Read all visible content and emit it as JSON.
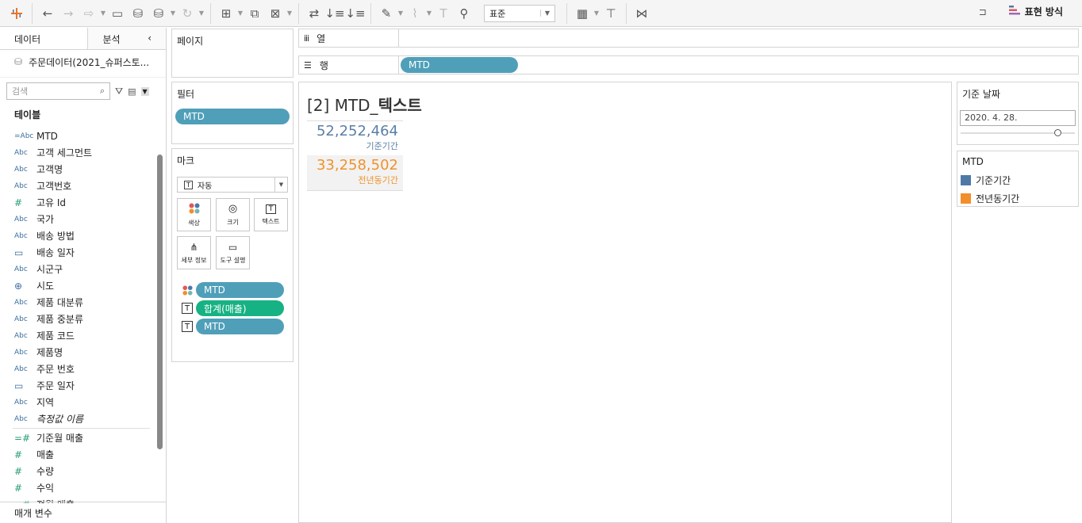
{
  "toolbar": {
    "fit_value": "표준",
    "show_me_label": "표현 방식"
  },
  "data_pane": {
    "tab_data": "데이터",
    "tab_analytics": "분석",
    "datasource_name": "주문데이터(2021_슈퍼스토...",
    "search_placeholder": "검색",
    "tables_title": "테이블",
    "fields": [
      {
        "icon": "=Abc",
        "name": "MTD"
      },
      {
        "icon": "Abc",
        "name": "고객 세그먼트"
      },
      {
        "icon": "Abc",
        "name": "고객명"
      },
      {
        "icon": "Abc",
        "name": "고객번호"
      },
      {
        "icon": "#",
        "name": "고유 Id"
      },
      {
        "icon": "Abc",
        "name": "국가"
      },
      {
        "icon": "Abc",
        "name": "배송 방법"
      },
      {
        "icon": "cal",
        "name": "배송 일자"
      },
      {
        "icon": "Abc",
        "name": "시군구"
      },
      {
        "icon": "globe",
        "name": "시도"
      },
      {
        "icon": "Abc",
        "name": "제품 대분류"
      },
      {
        "icon": "Abc",
        "name": "제품 중분류"
      },
      {
        "icon": "Abc",
        "name": "제품 코드"
      },
      {
        "icon": "Abc",
        "name": "제품명"
      },
      {
        "icon": "Abc",
        "name": "주문 번호"
      },
      {
        "icon": "cal",
        "name": "주문 일자"
      },
      {
        "icon": "Abc",
        "name": "지역"
      },
      {
        "icon": "Abc",
        "name": "측정값 이름"
      }
    ],
    "measures": [
      {
        "icon": "=#",
        "name": "기준월 매출"
      },
      {
        "icon": "#",
        "name": "매출"
      },
      {
        "icon": "#",
        "name": "수량"
      },
      {
        "icon": "#",
        "name": "수익"
      },
      {
        "icon": "=#",
        "name": "전월 매출"
      }
    ],
    "parameters_label": "매개 변수"
  },
  "pages_card": {
    "title": "페이지"
  },
  "filters_card": {
    "title": "필터",
    "pills": [
      "MTD"
    ]
  },
  "marks_card": {
    "title": "마크",
    "mark_type": "자동",
    "buttons": [
      "색상",
      "크기",
      "텍스트",
      "세부 정보",
      "도구 설명"
    ],
    "pills": [
      {
        "icon": "color",
        "label": "MTD",
        "kind": "dimension"
      },
      {
        "icon": "text",
        "label": "합계(매출)",
        "kind": "measure"
      },
      {
        "icon": "text",
        "label": "MTD",
        "kind": "dimension"
      }
    ]
  },
  "columns_shelf": {
    "label": "열"
  },
  "rows_shelf": {
    "label": "행",
    "pill": "MTD"
  },
  "view": {
    "title_prefix": "[2] MTD_",
    "title_bold": "텍스트",
    "rows": [
      {
        "value": "52,252,464",
        "label": "기준기간",
        "color": "#5b7fa6"
      },
      {
        "value": "33,258,502",
        "label": "전년동기간",
        "color": "#f0932b"
      }
    ]
  },
  "param_card": {
    "title": "기준 날짜",
    "value": "2020. 4. 28."
  },
  "legend_card": {
    "title": "MTD",
    "items": [
      {
        "label": "기준기간",
        "color": "#4e79a7"
      },
      {
        "label": "전년동기간",
        "color": "#f28e2b"
      }
    ]
  }
}
